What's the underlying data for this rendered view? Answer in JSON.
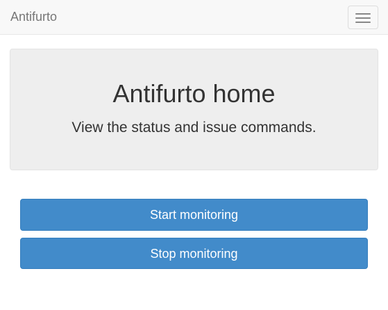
{
  "navbar": {
    "brand": "Antifurto",
    "toggle_icon": "hamburger-menu-icon"
  },
  "jumbotron": {
    "title": "Antifurto home",
    "subtitle": "View the status and issue commands."
  },
  "actions": {
    "start_label": "Start monitoring",
    "stop_label": "Stop monitoring"
  },
  "colors": {
    "primary": "#428bca",
    "navbar_bg": "#f8f8f8",
    "jumbotron_bg": "#eeeeee"
  }
}
